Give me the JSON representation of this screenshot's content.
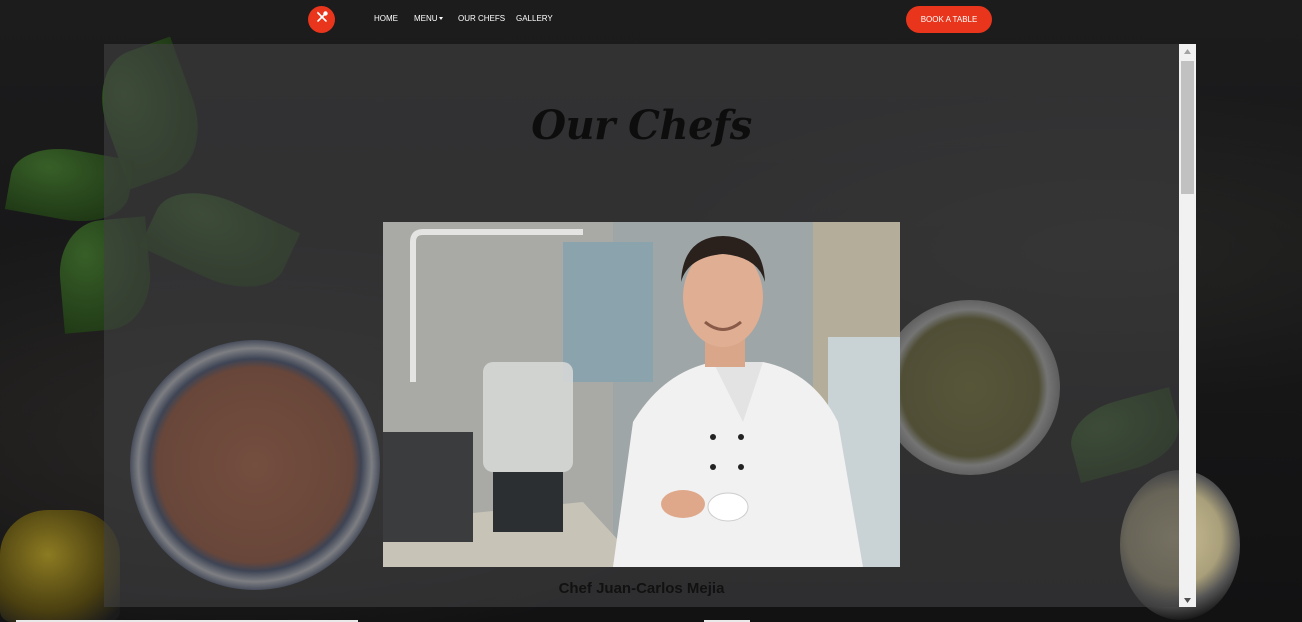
{
  "nav": {
    "logo_icon": "utensils-icon",
    "links": [
      {
        "label": "HOME"
      },
      {
        "label": "MENU",
        "has_dropdown": true
      },
      {
        "label": "OUR CHEFS"
      },
      {
        "label": "GALLERY"
      }
    ],
    "book_label": "BOOK A TABLE"
  },
  "page": {
    "title": "Our Chefs",
    "chef_name": "Chef Juan-Carlos Mejia",
    "chef_photo_icon": "chef-portrait-image"
  },
  "colors": {
    "accent": "#e8351b",
    "panel": "#404042",
    "background": "#161617"
  },
  "scrollbar": {
    "position_fraction": 0.0
  }
}
